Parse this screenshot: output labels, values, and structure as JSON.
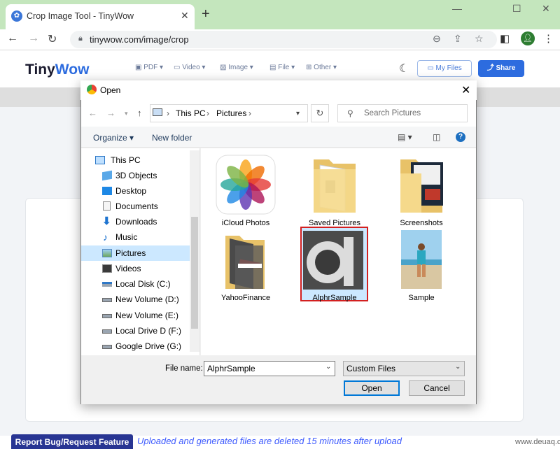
{
  "browser": {
    "tab_title": "Crop Image Tool - TinyWow",
    "url": "tinywow.com/image/crop",
    "profile_initial": "●"
  },
  "site": {
    "logo_a": "Tiny",
    "logo_b": "Wow",
    "nav": [
      "PDF",
      "Video",
      "Image",
      "File",
      "Other"
    ],
    "my_files": "My Files",
    "share": "Share",
    "report": "Report Bug/Request Feature",
    "notice": "Uploaded and generated files are deleted 15 minutes after upload"
  },
  "dialog": {
    "title": "Open",
    "breadcrumb": [
      "This PC",
      "Pictures"
    ],
    "search_placeholder": "Search Pictures",
    "organize": "Organize ▾",
    "new_folder": "New folder",
    "nav_items": [
      {
        "label": "This PC",
        "icon": "computer-icon"
      },
      {
        "label": "3D Objects",
        "icon": "cube-icon"
      },
      {
        "label": "Desktop",
        "icon": "desktop-icon"
      },
      {
        "label": "Documents",
        "icon": "document-icon"
      },
      {
        "label": "Downloads",
        "icon": "download-icon"
      },
      {
        "label": "Music",
        "icon": "music-icon"
      },
      {
        "label": "Pictures",
        "icon": "pictures-icon",
        "selected": true
      },
      {
        "label": "Videos",
        "icon": "video-icon"
      },
      {
        "label": "Local Disk (C:)",
        "icon": "drive-icon"
      },
      {
        "label": "New Volume (D:)",
        "icon": "drive-icon"
      },
      {
        "label": "New Volume (E:)",
        "icon": "drive-icon"
      },
      {
        "label": "Local Drive D (F:)",
        "icon": "drive-icon"
      },
      {
        "label": "Google Drive (G:)",
        "icon": "drive-icon"
      }
    ],
    "files": [
      "iCloud Photos",
      "Saved Pictures",
      "Screenshots",
      "YahooFinance",
      "AlphrSample",
      "Sample"
    ],
    "file_name_label": "File name:",
    "file_name_value": "AlphrSample",
    "filter_value": "Custom Files",
    "open_button": "Open",
    "cancel_button": "Cancel"
  },
  "watermark": "www.deuaq.com"
}
